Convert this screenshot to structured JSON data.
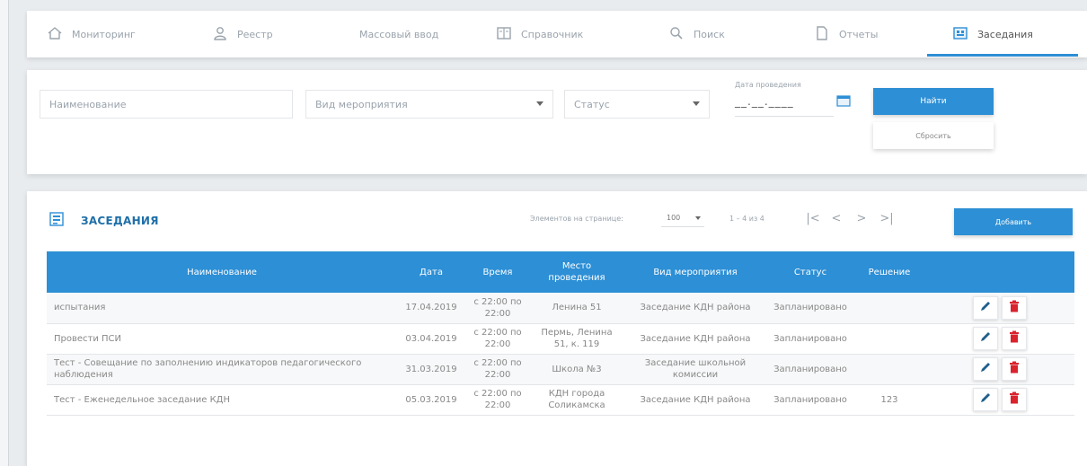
{
  "nav": {
    "items": [
      {
        "label": "Мониторинг",
        "icon": "home-icon",
        "active": false
      },
      {
        "label": "Реестр",
        "icon": "person-icon",
        "active": false
      },
      {
        "label": "Массовый ввод",
        "icon": "",
        "active": false
      },
      {
        "label": "Справочник",
        "icon": "book-icon",
        "active": false
      },
      {
        "label": "Поиск",
        "icon": "search-icon",
        "active": false
      },
      {
        "label": "Отчеты",
        "icon": "document-icon",
        "active": false
      },
      {
        "label": "Заседания",
        "icon": "meeting-icon",
        "active": true
      }
    ]
  },
  "filter": {
    "name_placeholder": "Наименование",
    "event_type_placeholder": "Вид мероприятия",
    "status_placeholder": "Статус",
    "date_label": "Дата проведения",
    "date_value": "__.__.____",
    "find_label": "Найти",
    "reset_label": "Сбросить"
  },
  "meetings": {
    "title": "ЗАСЕДАНИЯ",
    "per_page_label": "Элементов на странице:",
    "per_page_value": "100",
    "range": "1 – 4 из 4",
    "pager": {
      "first": "|<",
      "prev": "<",
      "next": ">",
      "last": ">|"
    },
    "add_label": "Добавить",
    "columns": [
      "Наименование",
      "Дата",
      "Время",
      "Место проведения",
      "Вид мероприятия",
      "Статус",
      "Решение",
      ""
    ],
    "rows": [
      {
        "name": "испытания",
        "date": "17.04.2019",
        "time": "с 22:00 по 22:00",
        "place": "Ленина 51",
        "type": "Заседание КДН района",
        "status": "Запланировано",
        "decision": ""
      },
      {
        "name": "Провести ПСИ",
        "date": "03.04.2019",
        "time": "с 22:00 по 22:00",
        "place": "Пермь, Ленина 51, к. 119",
        "type": "Заседание КДН района",
        "status": "Запланировано",
        "decision": ""
      },
      {
        "name": "Тест - Совещание по заполнению индикаторов педагогического наблюдения",
        "date": "31.03.2019",
        "time": "с 22:00 по 22:00",
        "place": "Школа №3",
        "type": "Заседание школьной комиссии",
        "status": "Запланировано",
        "decision": ""
      },
      {
        "name": "Тест - Еженедельное заседание КДН",
        "date": "05.03.2019",
        "time": "с 22:00 по 22:00",
        "place": "КДН города Соликамска",
        "type": "Заседание КДН района",
        "status": "Запланировано",
        "decision": "123"
      }
    ]
  },
  "colors": {
    "accent": "#2d8fd5",
    "title": "#1f6fa8",
    "delete": "#d9232d",
    "edit": "#1f5f8b"
  }
}
